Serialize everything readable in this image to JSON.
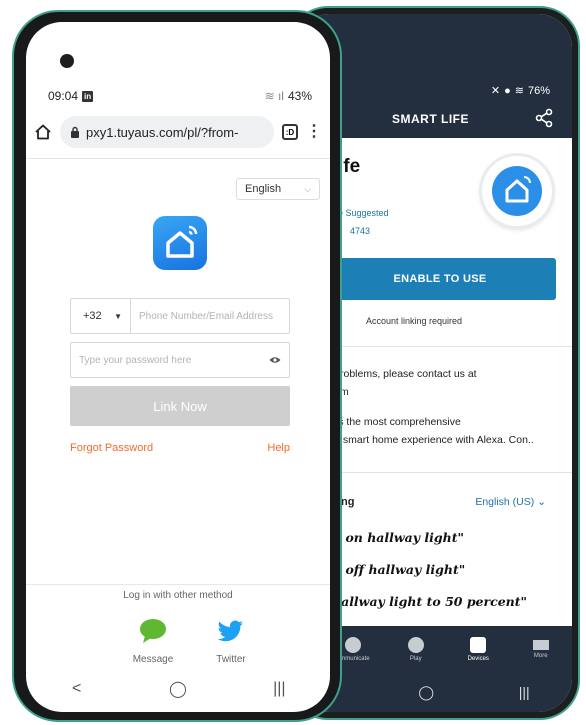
{
  "back_phone": {
    "status": {
      "battery": "76%"
    },
    "header_title": "SMART LIFE",
    "skill": {
      "name_partial": "ife",
      "suggested": "e Suggested",
      "rating_count": "4743",
      "enable_label": "ENABLE TO USE",
      "linking_note": "Account linking required"
    },
    "description_lines": [
      "y problems, please contact us at",
      ".com",
      "fers the most comprehensive",
      "led smart home experience with Alexa. Con.."
    ],
    "language": {
      "label": "ing",
      "value": "English (US)"
    },
    "utterances": [
      "n on hallway light\"",
      "n off hallway light\"",
      "hallway light to 50 percent\""
    ],
    "tabs": [
      {
        "label": "ommunicate"
      },
      {
        "label": "Play"
      },
      {
        "label": "Devices"
      },
      {
        "label": "More"
      }
    ]
  },
  "front_phone": {
    "status": {
      "time": "09:04",
      "battery": "43%"
    },
    "url": "pxy1.tuyaus.com/pl/?from-",
    "tab_count": ":D",
    "language_select": "English",
    "country_code": "+32",
    "phone_placeholder": "Phone Number/Email Address",
    "password_placeholder": "Type your password here",
    "link_button": "Link Now",
    "forgot_password": "Forgot Password",
    "help": "Help",
    "other_method_title": "Log in with other method",
    "social": {
      "message": "Message",
      "twitter": "Twitter"
    },
    "nav": {
      "back": "<",
      "home": "◯",
      "recents": "|||"
    }
  },
  "colors": {
    "accent_orange": "#f26b2a",
    "amazon_dark": "#232f3e",
    "enable_blue": "#1c7fb6",
    "phone_frame": "#3fa18c"
  }
}
